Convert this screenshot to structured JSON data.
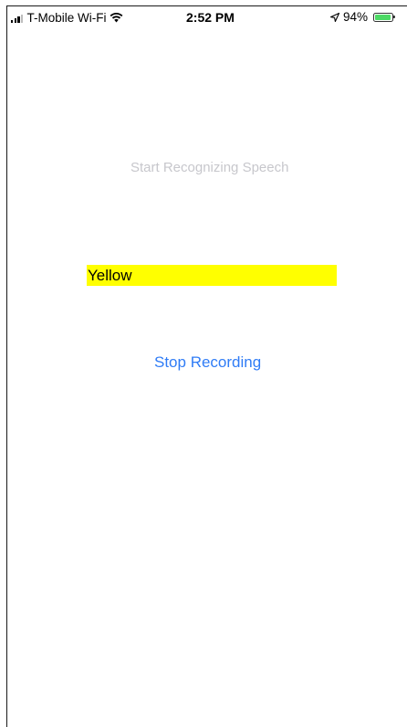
{
  "status_bar": {
    "carrier": "T-Mobile Wi-Fi",
    "time": "2:52 PM",
    "battery_percent": "94%",
    "battery_level": 0.94,
    "icons": [
      "signal-icon",
      "wifi-icon",
      "location-arrow-icon",
      "battery-icon"
    ]
  },
  "main": {
    "start_label": "Start Recognizing Speech",
    "recognized_text": "Yellow",
    "stop_button_label": "Stop Recording"
  },
  "colors": {
    "background": "#ffffff",
    "highlight": "#ffff00",
    "button_tint": "#2f7cf6",
    "disabled_text": "#c7c7cc",
    "battery": "#4cd964"
  }
}
